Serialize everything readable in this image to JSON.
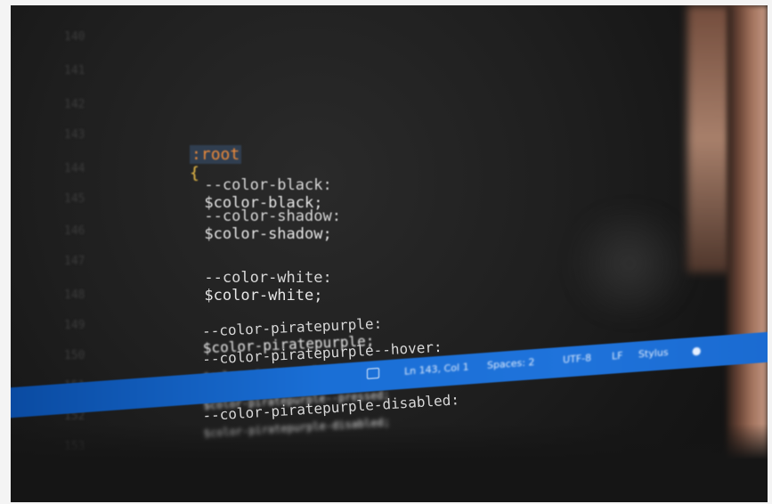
{
  "gutter": {
    "line_numbers": [
      "140",
      "141",
      "142",
      "143",
      "144",
      "145",
      "146",
      "147",
      "148",
      "149",
      "150",
      "151",
      "152",
      "153"
    ]
  },
  "code": {
    "selector": ":root",
    "open_brace": "{",
    "lines": [
      {
        "prop": "--color-black:",
        "value": "$color-black;"
      },
      {
        "prop": "--color-shadow:",
        "value": "$color-shadow;"
      },
      {
        "prop": "--color-white:",
        "value": "$color-white;"
      },
      {
        "prop": "--color-piratepurple:",
        "value": "$color-piratepurple;"
      },
      {
        "prop": "--color-piratepurple--hover:",
        "value": "$color-piratepurple--hover;"
      },
      {
        "prop": "--color-piratepurple--pressed:",
        "value": "$color-piratepurple--pressed;"
      },
      {
        "prop": "--color-piratepurple-disabled:",
        "value": "$color-piratepurple-disabled;"
      }
    ]
  },
  "statusbar": {
    "cursor_position": "Ln 143, Col 1",
    "indentation": "Spaces: 2",
    "encoding": "UTF-8",
    "line_ending": "LF",
    "language": "Stylus",
    "accent_color": "#1f73db"
  },
  "icons": {
    "terminal": "terminal-icon",
    "notifications": "bell-icon"
  }
}
